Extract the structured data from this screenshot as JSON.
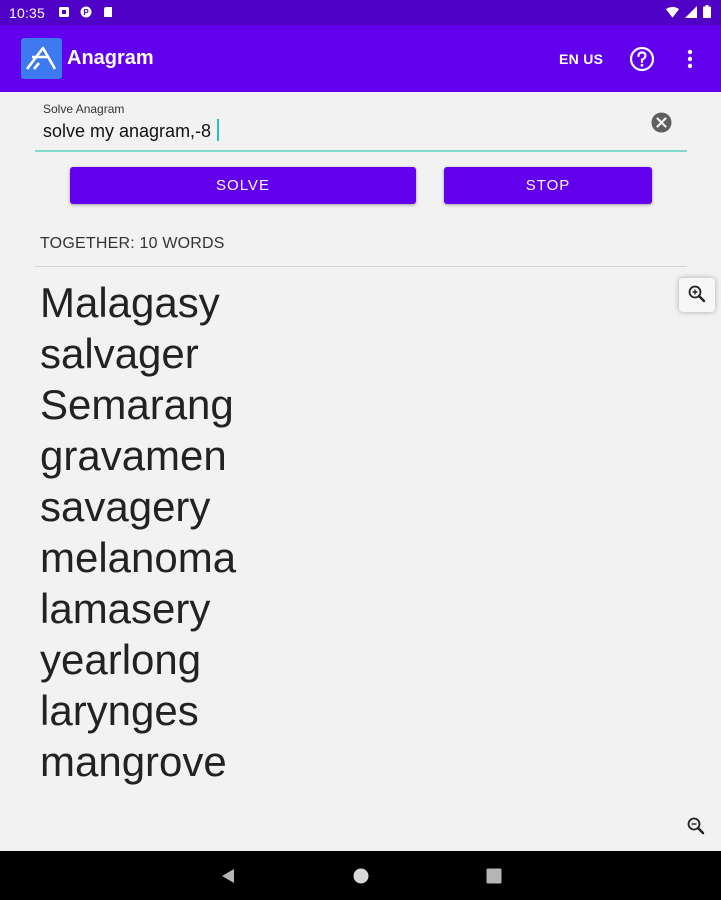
{
  "status_bar": {
    "time": "10:35",
    "notification_icons": [
      "notification-square-icon",
      "notification-p-icon",
      "sd-card-icon"
    ],
    "system_icons": [
      "wifi-icon",
      "signal-icon",
      "battery-icon"
    ]
  },
  "app_bar": {
    "title": "Anagram",
    "language": "EN US",
    "icons": [
      "anagram-logo-icon",
      "help-icon",
      "more-vert-icon"
    ],
    "color": "#6200ee"
  },
  "input": {
    "label": "Solve Anagram",
    "value": "solve my anagram,-8",
    "clear_icon": "clear-icon"
  },
  "buttons": {
    "solve": "SOLVE",
    "stop": "STOP"
  },
  "results": {
    "header": "TOGETHER: 10 WORDS",
    "words": [
      "Malagasy",
      "salvager",
      "Semarang",
      "gravamen",
      "savagery",
      "melanoma",
      "lamasery",
      "yearlong",
      "larynges",
      "mangrove"
    ]
  },
  "zoom": {
    "in_icon": "zoom-in-icon",
    "out_icon": "zoom-out-icon"
  },
  "nav_bar": {
    "icons": [
      "back-icon",
      "home-icon",
      "recents-icon"
    ]
  },
  "colors": {
    "accent": "#6200ee",
    "status_bar": "#4f02c5",
    "input_underline": "#7fdccc"
  }
}
